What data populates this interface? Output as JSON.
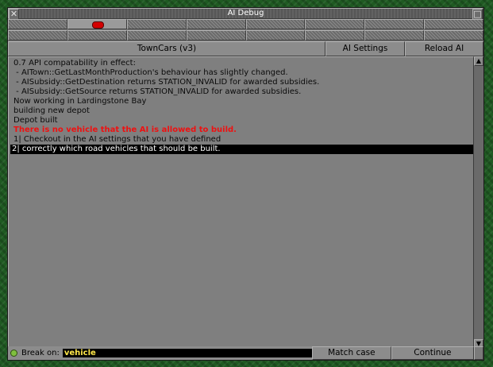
{
  "window": {
    "title": "AI Debug",
    "close_glyph": "✕",
    "stick_glyph": "□"
  },
  "tabs": {
    "row1_count": 8,
    "row2_count": 8,
    "active_index": 1,
    "active_indicator_color": "#d40000"
  },
  "header": {
    "ai_name": "TownCars (v3)",
    "ai_settings_label": "AI Settings",
    "reload_ai_label": "Reload AI"
  },
  "log": {
    "lines": [
      {
        "text": "0.7 API compatability in effect:",
        "style": "normal"
      },
      {
        "text": " - AITown::GetLastMonthProduction's behaviour has slightly changed.",
        "style": "normal"
      },
      {
        "text": " - AISubsidy::GetDestination returns STATION_INVALID for awarded subsidies.",
        "style": "normal"
      },
      {
        "text": " - AISubsidy::GetSource returns STATION_INVALID for awarded subsidies.",
        "style": "normal"
      },
      {
        "text": "Now working in Lardingstone Bay",
        "style": "normal"
      },
      {
        "text": "building new depot",
        "style": "normal"
      },
      {
        "text": "Depot built",
        "style": "normal"
      },
      {
        "text": "There is no vehicle that the AI is allowed to build.",
        "style": "error"
      },
      {
        "text": "1| Checkout in the AI settings that you have defined",
        "style": "normal"
      },
      {
        "text": "2| correctly which road vehicles that should be built.",
        "style": "selected"
      }
    ]
  },
  "footer": {
    "break_on_label": "Break on:",
    "break_on_value": "vehicle",
    "match_case_label": "Match case",
    "continue_label": "Continue"
  },
  "colors": {
    "window_bg": "#7f7f7f",
    "error_text": "#ee1111",
    "selection_bg": "#000000",
    "break_text": "#ffe84a"
  },
  "icons": {
    "close": "close-icon",
    "sticky": "sticky-icon",
    "scroll_up": "arrow-up-icon",
    "scroll_down": "arrow-down-icon",
    "status": "status-dot-icon"
  }
}
